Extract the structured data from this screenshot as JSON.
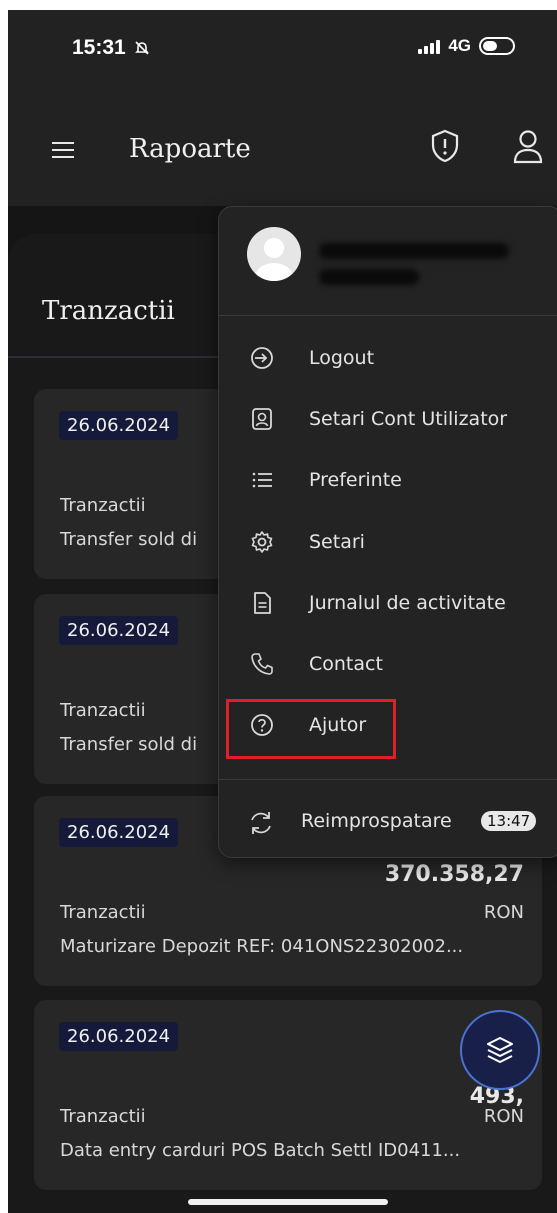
{
  "status_bar": {
    "time": "15:31",
    "network": "4G"
  },
  "header": {
    "title": "Rapoarte"
  },
  "section": {
    "title": "Tranzactii"
  },
  "transactions": [
    {
      "date": "26.06.2024",
      "amount": "",
      "type": "Tranzactii",
      "currency": "",
      "description": "Transfer sold di"
    },
    {
      "date": "26.06.2024",
      "amount": "",
      "type": "Tranzactii",
      "currency": "",
      "description": "Transfer sold di"
    },
    {
      "date": "26.06.2024",
      "amount": "370.358,27",
      "type": "Tranzactii",
      "currency": "RON",
      "description": "Maturizare Depozit REF: 041ONS22302002..."
    },
    {
      "date": "26.06.2024",
      "amount": "493,",
      "type": "Tranzactii",
      "currency": "RON",
      "description": "Data entry carduri POS Batch Settl ID0411..."
    }
  ],
  "dropdown": {
    "menu": [
      {
        "label": "Logout",
        "icon": "logout-icon"
      },
      {
        "label": "Setari Cont Utilizator",
        "icon": "user-account-icon"
      },
      {
        "label": "Preferinte",
        "icon": "list-icon"
      },
      {
        "label": "Setari",
        "icon": "gear-icon"
      },
      {
        "label": "Jurnalul de activitate",
        "icon": "document-icon"
      },
      {
        "label": "Contact",
        "icon": "phone-icon"
      },
      {
        "label": "Ajutor",
        "icon": "help-icon"
      }
    ],
    "refresh": {
      "label": "Reimprospatare",
      "time": "13:47",
      "icon": "refresh-icon"
    }
  },
  "colors": {
    "highlight": "#e01f27",
    "badge_bg": "#15193a",
    "fab_border": "#4a74d4"
  }
}
